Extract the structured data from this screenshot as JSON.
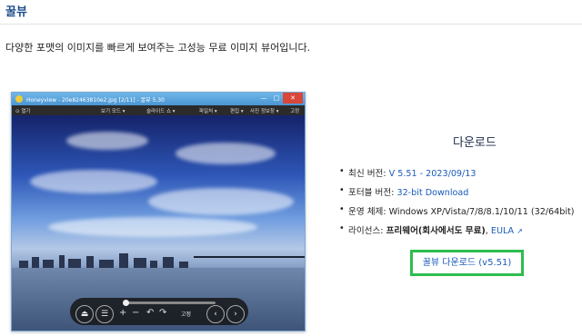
{
  "page": {
    "title": "꿀뷰",
    "tagline": "다양한 포맷의 이미지를 빠르게 보여주는 고성능 무료 이미지 뷰어입니다."
  },
  "screenshot": {
    "window_title": "Honeyview - 20e82463810e2.jpg [2/11] - 꿀뷰 5.30",
    "win_min": "—",
    "win_max": "□",
    "win_close": "✕",
    "toolbar": {
      "open": "⊙ 열기",
      "view_mode": "보기 모드 ▾",
      "slideshow": "슬라이드 쇼 ▾",
      "tools": "파일처 ▾",
      "edit": "편집 ▾",
      "photo_info": "사진 정보창 ▾",
      "fit": "고정"
    },
    "controls": {
      "eject": "⏏",
      "menu": "☰",
      "plus": "+",
      "minus": "−",
      "rotate_left": "↶",
      "rotate_right": "↷",
      "zoom_label": "고정",
      "prev": "‹",
      "next": "›"
    }
  },
  "download": {
    "title": "다운로드",
    "latest_label": "최신 버전: ",
    "latest_value": "V 5.51 - 2023/09/13",
    "portable_label": "포터블 버전: ",
    "portable_value": "32-bit Download",
    "os_label": "운영 체제: ",
    "os_value": "Windows XP/Vista/7/8/8.1/10/11 (32/64bit)",
    "license_label": "라이선스: ",
    "license_value": "프리웨어(회사에서도 무료)",
    "license_sep": ", ",
    "eula": "EULA",
    "ext_icon": "↗",
    "button": "꿀뷰 다운로드 (v5.51)"
  },
  "colors": {
    "title": "#1f4e8c",
    "link": "#1a5bb8",
    "button_border": "#2ebd4e"
  }
}
